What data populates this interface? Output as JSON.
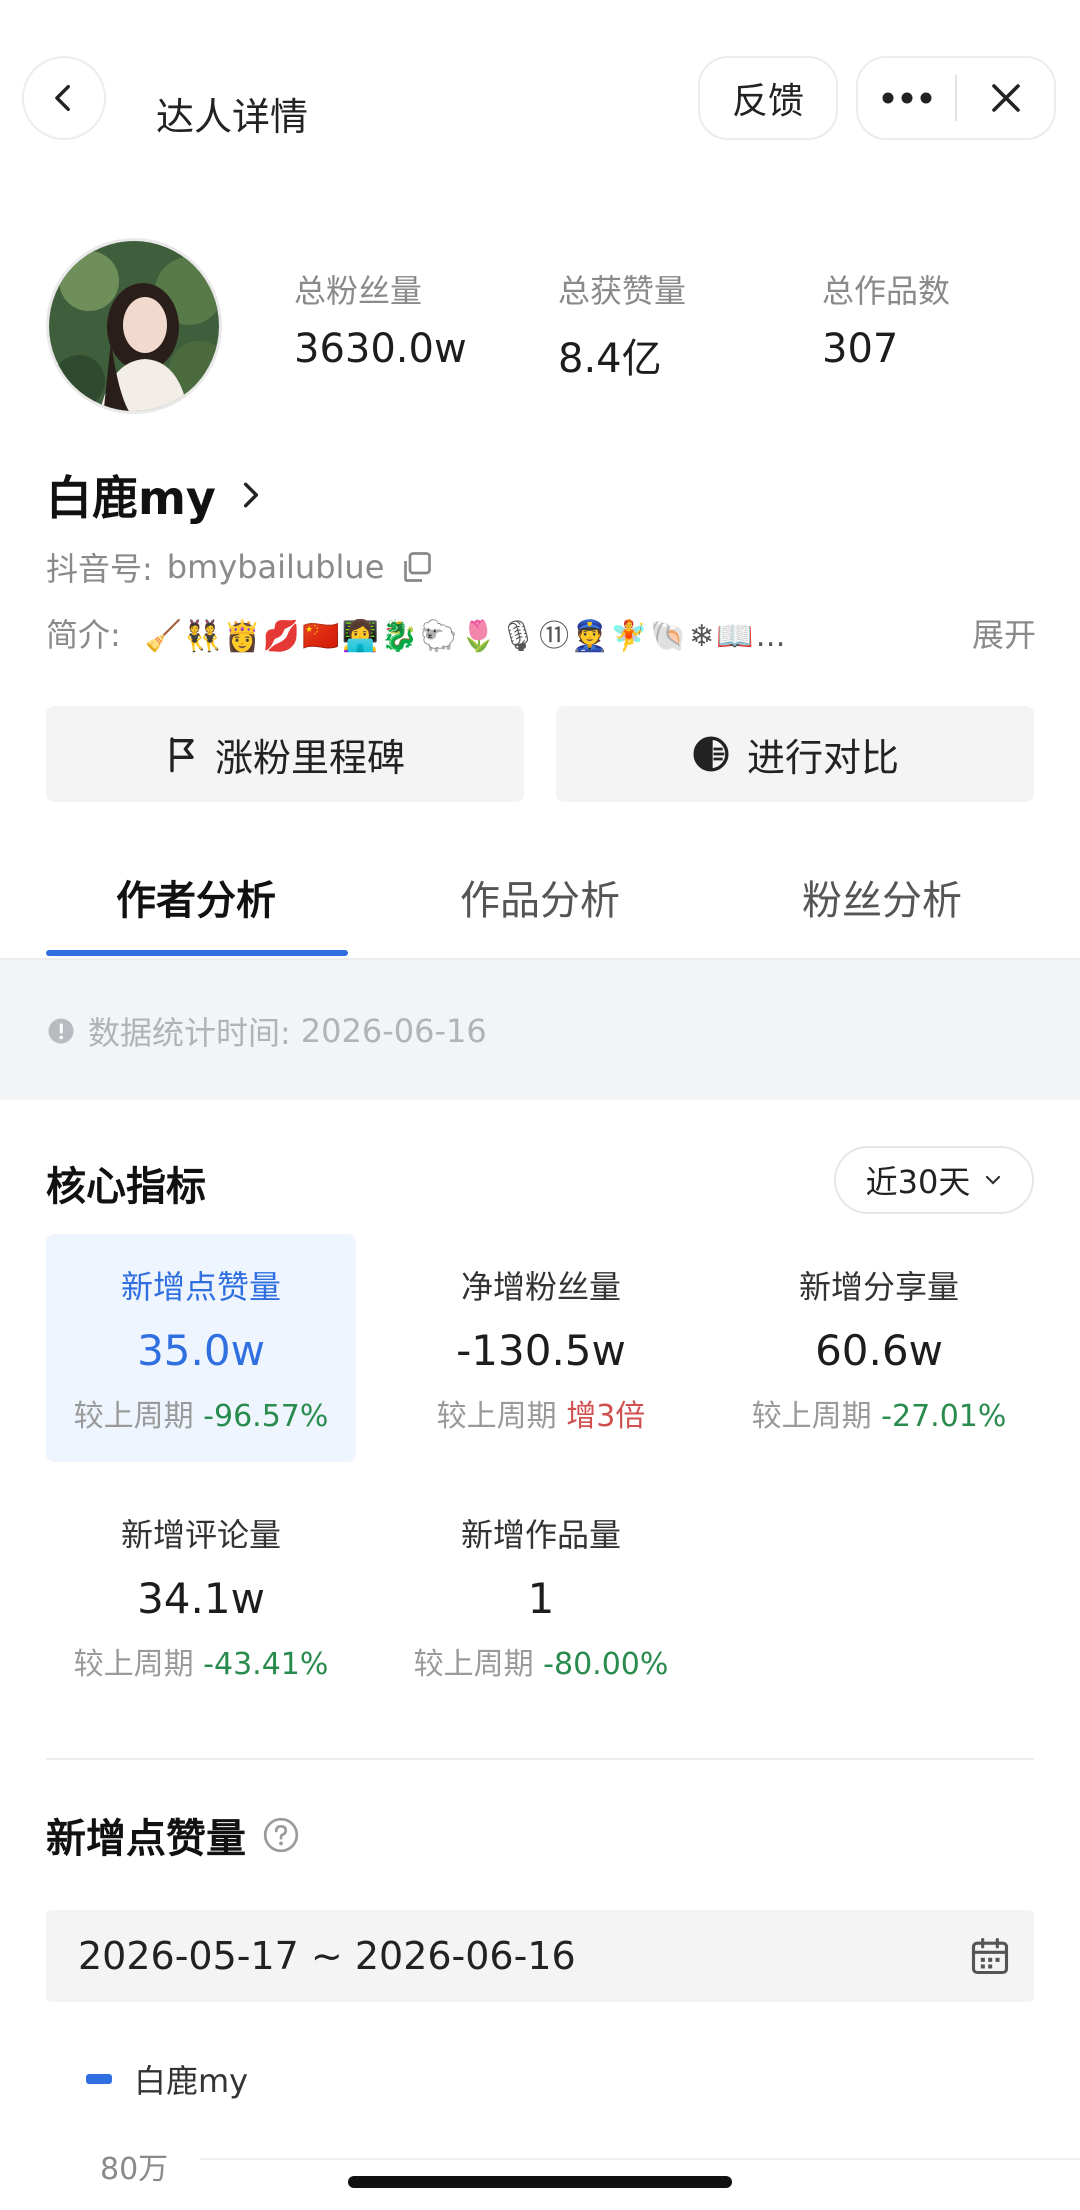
{
  "header": {
    "title": "达人详情",
    "feedback_label": "反馈"
  },
  "profile": {
    "stats": [
      {
        "label": "总粉丝量",
        "value": "3630.0w"
      },
      {
        "label": "总获赞量",
        "value": "8.4亿"
      },
      {
        "label": "总作品数",
        "value": "307"
      }
    ],
    "name": "白鹿my",
    "id_label": "抖音号:",
    "id_value": "bmybailublue",
    "bio_label": "简介:",
    "bio_text": "🧹👯👸💋🇨🇳👩‍💻🐉🐑🌷🎙⑪👮🧚🐚❄📖…",
    "expand_label": "展开"
  },
  "actions": {
    "milestone_label": "涨粉里程碑",
    "compare_label": "进行对比"
  },
  "tabs": [
    {
      "label": "作者分析",
      "active": true
    },
    {
      "label": "作品分析",
      "active": false
    },
    {
      "label": "粉丝分析",
      "active": false
    }
  ],
  "notice": {
    "label": "数据统计时间:",
    "date": "2026-06-16"
  },
  "core": {
    "title": "核心指标",
    "range_label": "近30天",
    "compare_prefix": "较上周期",
    "metrics": [
      {
        "label": "新增点赞量",
        "value": "35.0w",
        "change": "-96.57%",
        "change_color": "#2a8b4e",
        "selected": true
      },
      {
        "label": "净增粉丝量",
        "value": "-130.5w",
        "change": "增3倍",
        "change_color": "#d05050",
        "selected": false
      },
      {
        "label": "新增分享量",
        "value": "60.6w",
        "change": "-27.01%",
        "change_color": "#2a8b4e",
        "selected": false
      },
      {
        "label": "新增评论量",
        "value": "34.1w",
        "change": "-43.41%",
        "change_color": "#2a8b4e",
        "selected": false
      },
      {
        "label": "新增作品量",
        "value": "1",
        "change": "-80.00%",
        "change_color": "#2a8b4e",
        "selected": false
      }
    ]
  },
  "likes_section": {
    "title": "新增点赞量",
    "date_range": "2026-05-17  ~  2026-06-16",
    "legend_name": "白鹿my",
    "y_tick_top": "80万"
  },
  "colors": {
    "accent": "#2f6fe0",
    "positive_change": "#2a8b4e",
    "negative_change": "#d05050"
  }
}
